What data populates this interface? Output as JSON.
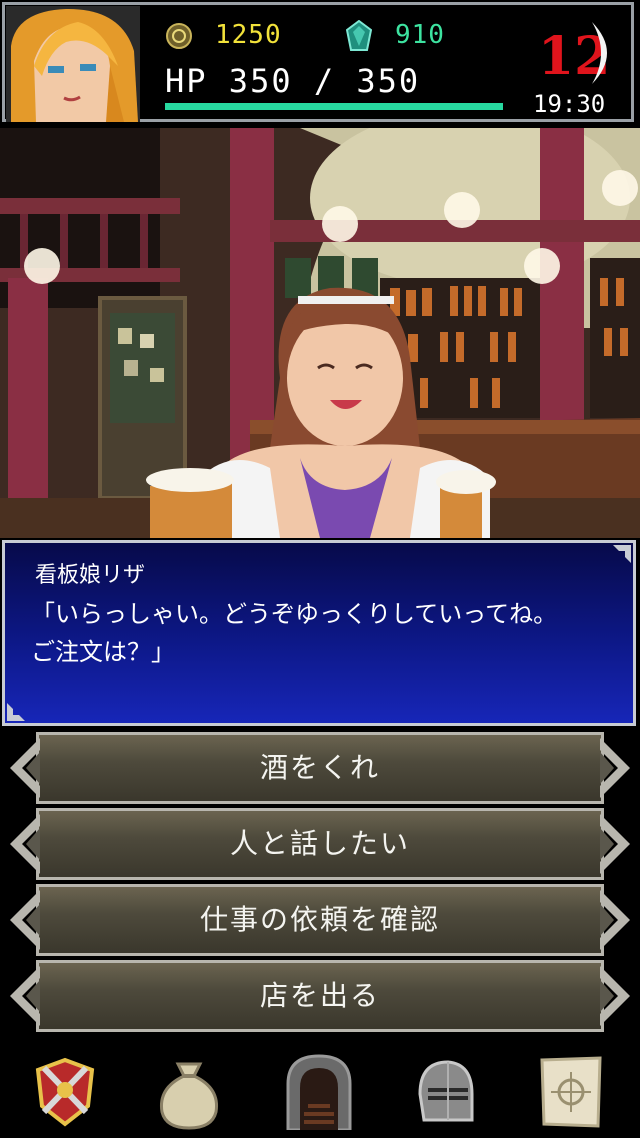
{
  "status": {
    "gold": "1250",
    "gems": "910",
    "hp_text": "HP 350 / 350",
    "hp_fraction": 1.0,
    "day": "12",
    "time": "19:30"
  },
  "dialog": {
    "speaker": "看板娘リザ",
    "text": "「いらっしゃい。どうぞゆっくりしていってね。\nご注文は？」"
  },
  "choices": [
    {
      "label": "酒をくれ"
    },
    {
      "label": "人と話したい"
    },
    {
      "label": "仕事の依頼を確認"
    },
    {
      "label": "店を出る"
    }
  ],
  "nav": {
    "items": [
      "crest-icon",
      "money-bag-icon",
      "dungeon-door-icon",
      "knight-helmet-icon",
      "map-icon"
    ]
  },
  "colors": {
    "gold": "#f2e23a",
    "gems": "#3de3a0",
    "hp_bar": "#27d9a0",
    "day": "#e0141c",
    "dialog_bg": "#0d1888"
  }
}
